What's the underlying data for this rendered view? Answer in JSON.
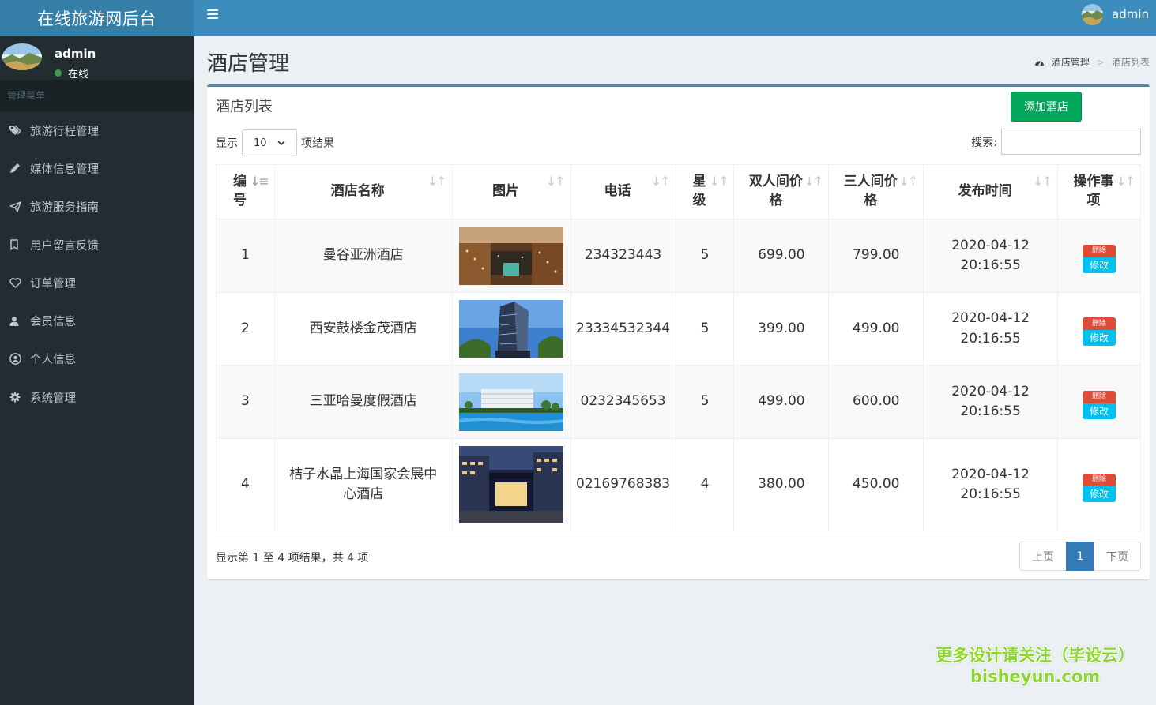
{
  "app": {
    "title": "在线旅游网后台"
  },
  "sidebar": {
    "user": {
      "name": "admin",
      "status": "在线"
    },
    "menu_header": "管理菜单",
    "items": [
      {
        "label": "旅游行程管理",
        "icon": "tag-icon"
      },
      {
        "label": "媒体信息管理",
        "icon": "pencil-icon"
      },
      {
        "label": "旅游服务指南",
        "icon": "send-icon"
      },
      {
        "label": "用户留言反馈",
        "icon": "bookmark-icon"
      },
      {
        "label": "订单管理",
        "icon": "heart-icon"
      },
      {
        "label": "会员信息",
        "icon": "user-icon"
      },
      {
        "label": "个人信息",
        "icon": "user-circle-icon"
      },
      {
        "label": "系统管理",
        "icon": "gear-icon"
      }
    ]
  },
  "topbar": {
    "username": "admin"
  },
  "page": {
    "title": "酒店管理",
    "breadcrumb": {
      "root": "酒店管理",
      "current": "酒店列表"
    }
  },
  "box": {
    "title": "酒店列表",
    "add_label": "添加酒店",
    "show_prefix": "显示",
    "page_length": "10",
    "show_suffix": "项结果",
    "search_label": "搜索:",
    "search_value": "",
    "info": "显示第 1 至 4 项结果，共 4 项"
  },
  "table": {
    "columns": [
      {
        "label": "编号",
        "lines": [
          "编",
          "号"
        ]
      },
      {
        "label": "酒店名称",
        "lines": [
          "酒店名称"
        ]
      },
      {
        "label": "图片",
        "lines": [
          "图片"
        ]
      },
      {
        "label": "电话",
        "lines": [
          "电话"
        ]
      },
      {
        "label": "星级",
        "lines": [
          "星",
          "级"
        ]
      },
      {
        "label": "双人间价格",
        "lines": [
          "双人间价",
          "格"
        ]
      },
      {
        "label": "三人间价格",
        "lines": [
          "三人间价",
          "格"
        ]
      },
      {
        "label": "发布时间",
        "lines": [
          "发布时间"
        ]
      },
      {
        "label": "操作事项",
        "lines": [
          "操作事",
          "项"
        ]
      }
    ],
    "rows": [
      {
        "id": "1",
        "name": "曼谷亚洲酒店",
        "phone": "234323443",
        "star": "5",
        "double": "699.00",
        "triple": "799.00",
        "date": "2020-04-12",
        "time": "20:16:55"
      },
      {
        "id": "2",
        "name": "西安鼓楼金茂酒店",
        "phone": "23334532344",
        "star": "5",
        "double": "399.00",
        "triple": "499.00",
        "date": "2020-04-12",
        "time": "20:16:55"
      },
      {
        "id": "3",
        "name": "三亚哈曼度假酒店",
        "phone": "0232345653",
        "star": "5",
        "double": "499.00",
        "triple": "600.00",
        "date": "2020-04-12",
        "time": "20:16:55"
      },
      {
        "id": "4",
        "name": "桔子水晶上海国家会展中心酒店",
        "phone": "02169768383",
        "star": "4",
        "double": "380.00",
        "triple": "450.00",
        "date": "2020-04-12",
        "time": "20:16:55"
      }
    ],
    "ops": {
      "delete": "删除",
      "edit": "修改"
    }
  },
  "pagination": {
    "prev": "上页",
    "current": "1",
    "next": "下页"
  },
  "watermark": {
    "line1": "更多设计请关注（毕设云）",
    "line2": "bisheyun.com"
  },
  "colors": {
    "topbar": "#3c8dbc",
    "logo_bg": "#367fa9",
    "sidebar": "#222d32",
    "add_button": "#00a65a",
    "delete_button": "#dd4b39",
    "edit_button": "#00c0ef",
    "pager_active": "#337ab7"
  }
}
